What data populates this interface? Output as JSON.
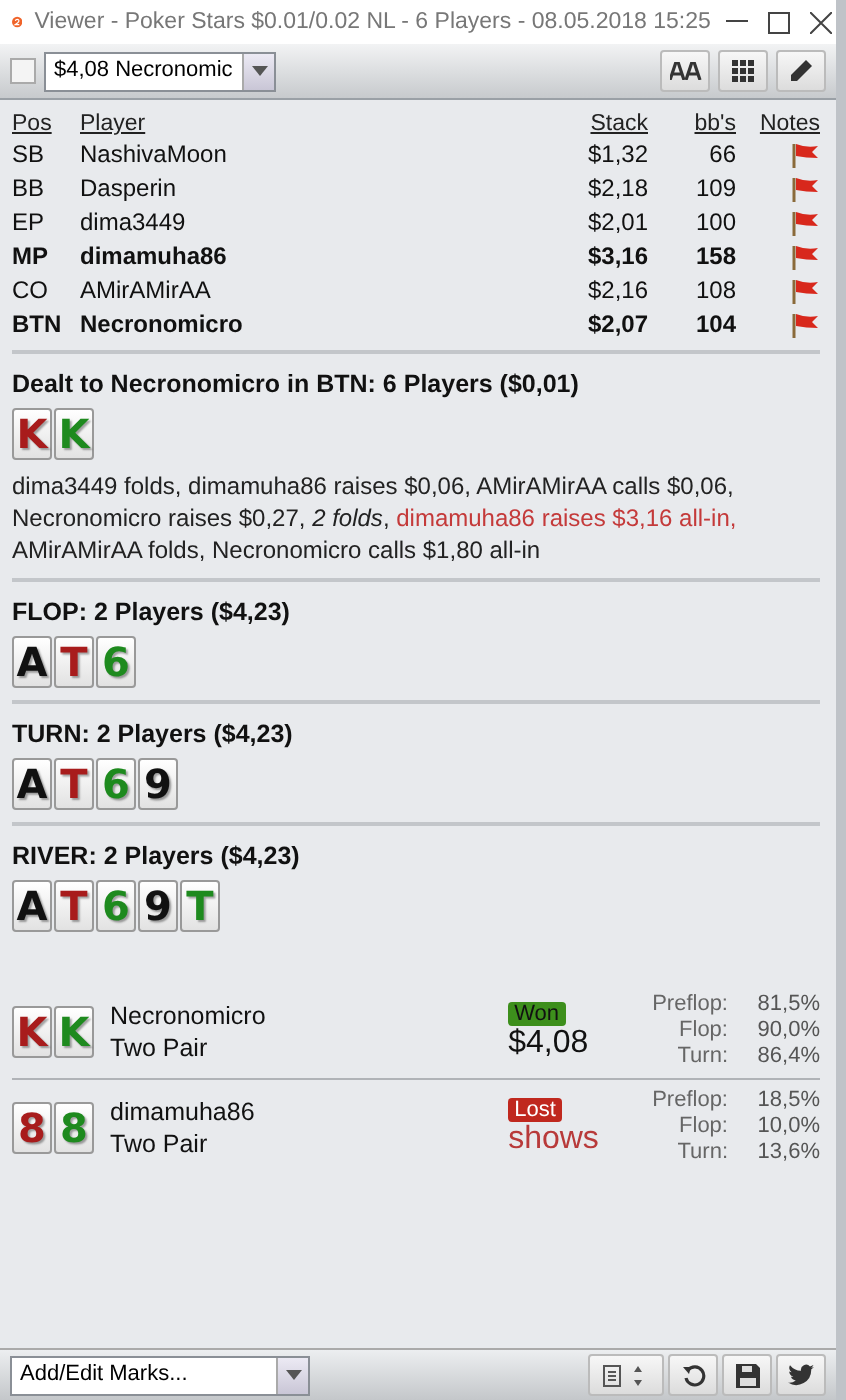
{
  "window": {
    "title": "Viewer - Poker Stars $0.01/0.02 NL - 6 Players - 08.05.2018 15:25"
  },
  "toolbar": {
    "checked": false,
    "hand_select": "$4,08 Necronomic"
  },
  "players": {
    "columns": [
      "Pos",
      "Player",
      "Stack",
      "bb's",
      "Notes"
    ],
    "rows": [
      {
        "pos": "SB",
        "player": "NashivaMoon",
        "stack": "$1,32",
        "bb": "66",
        "highlighted": false
      },
      {
        "pos": "BB",
        "player": "Dasperin",
        "stack": "$2,18",
        "bb": "109",
        "highlighted": false
      },
      {
        "pos": "EP",
        "player": "dima3449",
        "stack": "$2,01",
        "bb": "100",
        "highlighted": false
      },
      {
        "pos": "MP",
        "player": "dimamuha86",
        "stack": "$3,16",
        "bb": "158",
        "highlighted": true
      },
      {
        "pos": "CO",
        "player": "AMirAMirAA",
        "stack": "$2,16",
        "bb": "108",
        "highlighted": false
      },
      {
        "pos": "BTN",
        "player": "Necronomicro",
        "stack": "$2,07",
        "bb": "104",
        "highlighted": true
      }
    ]
  },
  "streets": [
    {
      "title": "Dealt to Necronomicro in BTN: 6 Players ($0,01)",
      "cards": [
        {
          "rank": "K",
          "color": "#a81c1c"
        },
        {
          "rank": "K",
          "color": "#1e8a1e"
        }
      ],
      "actions": [
        {
          "kind": "plain",
          "text": "dima3449 folds, dimamuha86 raises $0,06, AMirAMirAA calls $0,06, Necronomicro raises $0,27, "
        },
        {
          "kind": "summary",
          "text": "2 folds"
        },
        {
          "kind": "plain",
          "text": ", "
        },
        {
          "kind": "allin",
          "text": "dimamuha86 raises $3,16 all-in,"
        },
        {
          "kind": "plain",
          "text": " AMirAMirAA folds, Necronomicro calls $1,80 all-in"
        }
      ]
    },
    {
      "title": "FLOP: 2 Players ($4,23)",
      "cards": [
        {
          "rank": "A",
          "color": "#111111"
        },
        {
          "rank": "T",
          "color": "#a81c1c"
        },
        {
          "rank": "6",
          "color": "#1e8a1e"
        }
      ]
    },
    {
      "title": "TURN: 2 Players ($4,23)",
      "cards": [
        {
          "rank": "A",
          "color": "#111111"
        },
        {
          "rank": "T",
          "color": "#a81c1c"
        },
        {
          "rank": "6",
          "color": "#1e8a1e"
        },
        {
          "rank": "9",
          "color": "#111111"
        }
      ]
    },
    {
      "title": "RIVER: 2 Players ($4,23)",
      "cards": [
        {
          "rank": "A",
          "color": "#111111"
        },
        {
          "rank": "T",
          "color": "#a81c1c"
        },
        {
          "rank": "6",
          "color": "#1e8a1e"
        },
        {
          "rank": "9",
          "color": "#111111"
        },
        {
          "rank": "T",
          "color": "#1e8a1e"
        }
      ]
    }
  ],
  "results": [
    {
      "cards": [
        {
          "rank": "K",
          "color": "#a81c1c"
        },
        {
          "rank": "K",
          "color": "#1e8a1e"
        }
      ],
      "name": "Necronomicro",
      "hand": "Two Pair",
      "kind": "won",
      "badge": "Won",
      "amount": "$4,08",
      "equity": [
        {
          "label": "Preflop:",
          "value": "81,5%"
        },
        {
          "label": "Flop:",
          "value": "90,0%"
        },
        {
          "label": "Turn:",
          "value": "86,4%"
        }
      ]
    },
    {
      "cards": [
        {
          "rank": "8",
          "color": "#a81c1c"
        },
        {
          "rank": "8",
          "color": "#1e8a1e"
        }
      ],
      "name": "dimamuha86",
      "hand": "Two Pair",
      "kind": "lost",
      "badge": "Lost",
      "amount": "shows",
      "equity": [
        {
          "label": "Preflop:",
          "value": "18,5%"
        },
        {
          "label": "Flop:",
          "value": "10,0%"
        },
        {
          "label": "Turn:",
          "value": "13,6%"
        }
      ]
    }
  ],
  "footer": {
    "marks_select": "Add/Edit Marks..."
  }
}
